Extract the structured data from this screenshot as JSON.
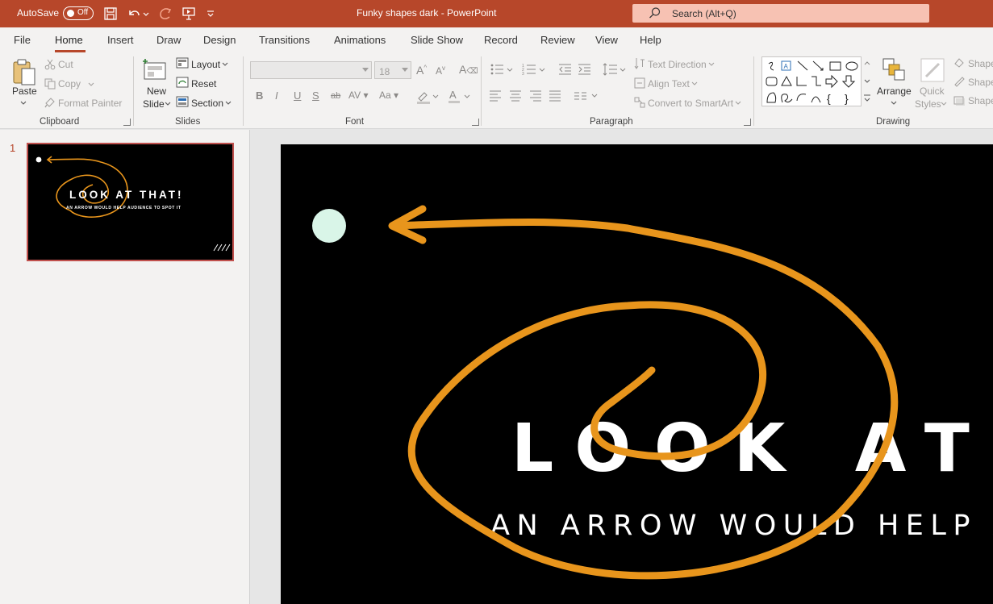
{
  "titlebar": {
    "autosave_label": "AutoSave",
    "autosave_state": "Off",
    "doc_title": "Funky shapes dark  -  PowerPoint",
    "search_placeholder": "Search (Alt+Q)"
  },
  "menu": {
    "tabs": [
      "File",
      "Home",
      "Insert",
      "Draw",
      "Design",
      "Transitions",
      "Animations",
      "Slide Show",
      "Record",
      "Review",
      "View",
      "Help"
    ],
    "active": "Home"
  },
  "ribbon": {
    "clipboard": {
      "paste": "Paste",
      "cut": "Cut",
      "copy": "Copy",
      "format_painter": "Format Painter",
      "label": "Clipboard"
    },
    "slides": {
      "new_slide_1": "New",
      "new_slide_2": "Slide",
      "layout": "Layout",
      "reset": "Reset",
      "section": "Section",
      "label": "Slides"
    },
    "font": {
      "size": "18",
      "label": "Font"
    },
    "paragraph": {
      "text_direction": "Text Direction",
      "align_text": "Align Text",
      "convert_smartart": "Convert to SmartArt",
      "label": "Paragraph"
    },
    "drawing": {
      "arrange": "Arrange",
      "quick_styles_1": "Quick",
      "quick_styles_2": "Styles",
      "shape_1": "Shape",
      "shape_2": "Shape",
      "shape_3": "Shape",
      "label": "Drawing"
    }
  },
  "slides_pane": {
    "slide_number": "1",
    "thumb_title": "LOOK AT THAT!",
    "thumb_subtitle": "AN ARROW WOULD HELP AUDIENCE TO SPOT IT"
  },
  "slide": {
    "title": "LOOK AT THAT!",
    "subtitle": "AN ARROW WOULD HELP AUDIENCE TO SPOT IT",
    "accent_color": "#e8951c",
    "dot_color": "#d9f5e8"
  }
}
